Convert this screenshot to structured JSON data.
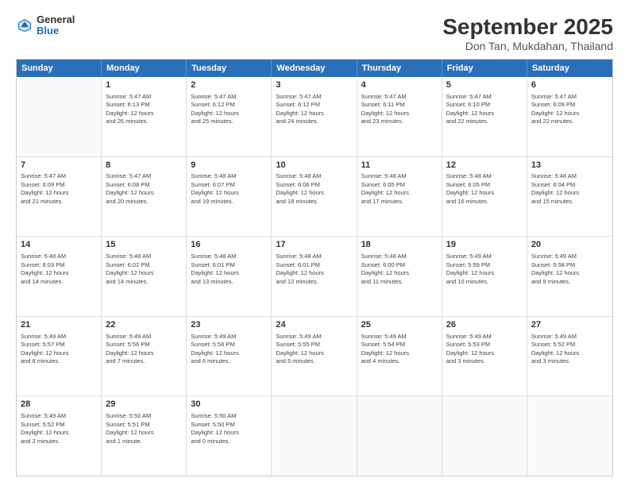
{
  "logo": {
    "general": "General",
    "blue": "Blue"
  },
  "title": "September 2025",
  "subtitle": "Don Tan, Mukdahan, Thailand",
  "headers": [
    "Sunday",
    "Monday",
    "Tuesday",
    "Wednesday",
    "Thursday",
    "Friday",
    "Saturday"
  ],
  "weeks": [
    [
      {
        "day": "",
        "text": ""
      },
      {
        "day": "1",
        "text": "Sunrise: 5:47 AM\nSunset: 6:13 PM\nDaylight: 12 hours\nand 26 minutes."
      },
      {
        "day": "2",
        "text": "Sunrise: 5:47 AM\nSunset: 6:12 PM\nDaylight: 12 hours\nand 25 minutes."
      },
      {
        "day": "3",
        "text": "Sunrise: 5:47 AM\nSunset: 6:12 PM\nDaylight: 12 hours\nand 24 minutes."
      },
      {
        "day": "4",
        "text": "Sunrise: 5:47 AM\nSunset: 6:11 PM\nDaylight: 12 hours\nand 23 minutes."
      },
      {
        "day": "5",
        "text": "Sunrise: 5:47 AM\nSunset: 6:10 PM\nDaylight: 12 hours\nand 22 minutes."
      },
      {
        "day": "6",
        "text": "Sunrise: 5:47 AM\nSunset: 6:09 PM\nDaylight: 12 hours\nand 22 minutes."
      }
    ],
    [
      {
        "day": "7",
        "text": "Sunrise: 5:47 AM\nSunset: 6:09 PM\nDaylight: 12 hours\nand 21 minutes."
      },
      {
        "day": "8",
        "text": "Sunrise: 5:47 AM\nSunset: 6:08 PM\nDaylight: 12 hours\nand 20 minutes."
      },
      {
        "day": "9",
        "text": "Sunrise: 5:48 AM\nSunset: 6:07 PM\nDaylight: 12 hours\nand 19 minutes."
      },
      {
        "day": "10",
        "text": "Sunrise: 5:48 AM\nSunset: 6:06 PM\nDaylight: 12 hours\nand 18 minutes."
      },
      {
        "day": "11",
        "text": "Sunrise: 5:48 AM\nSunset: 6:05 PM\nDaylight: 12 hours\nand 17 minutes."
      },
      {
        "day": "12",
        "text": "Sunrise: 5:48 AM\nSunset: 6:05 PM\nDaylight: 12 hours\nand 16 minutes."
      },
      {
        "day": "13",
        "text": "Sunrise: 5:48 AM\nSunset: 6:04 PM\nDaylight: 12 hours\nand 15 minutes."
      }
    ],
    [
      {
        "day": "14",
        "text": "Sunrise: 5:48 AM\nSunset: 6:03 PM\nDaylight: 12 hours\nand 14 minutes."
      },
      {
        "day": "15",
        "text": "Sunrise: 5:48 AM\nSunset: 6:02 PM\nDaylight: 12 hours\nand 14 minutes."
      },
      {
        "day": "16",
        "text": "Sunrise: 5:48 AM\nSunset: 6:01 PM\nDaylight: 12 hours\nand 13 minutes."
      },
      {
        "day": "17",
        "text": "Sunrise: 5:48 AM\nSunset: 6:01 PM\nDaylight: 12 hours\nand 12 minutes."
      },
      {
        "day": "18",
        "text": "Sunrise: 5:48 AM\nSunset: 6:00 PM\nDaylight: 12 hours\nand 11 minutes."
      },
      {
        "day": "19",
        "text": "Sunrise: 5:49 AM\nSunset: 5:59 PM\nDaylight: 12 hours\nand 10 minutes."
      },
      {
        "day": "20",
        "text": "Sunrise: 5:49 AM\nSunset: 5:58 PM\nDaylight: 12 hours\nand 9 minutes."
      }
    ],
    [
      {
        "day": "21",
        "text": "Sunrise: 5:49 AM\nSunset: 5:57 PM\nDaylight: 12 hours\nand 8 minutes."
      },
      {
        "day": "22",
        "text": "Sunrise: 5:49 AM\nSunset: 5:56 PM\nDaylight: 12 hours\nand 7 minutes."
      },
      {
        "day": "23",
        "text": "Sunrise: 5:49 AM\nSunset: 5:56 PM\nDaylight: 12 hours\nand 6 minutes."
      },
      {
        "day": "24",
        "text": "Sunrise: 5:49 AM\nSunset: 5:55 PM\nDaylight: 12 hours\nand 5 minutes."
      },
      {
        "day": "25",
        "text": "Sunrise: 5:49 AM\nSunset: 5:54 PM\nDaylight: 12 hours\nand 4 minutes."
      },
      {
        "day": "26",
        "text": "Sunrise: 5:49 AM\nSunset: 5:53 PM\nDaylight: 12 hours\nand 3 minutes."
      },
      {
        "day": "27",
        "text": "Sunrise: 5:49 AM\nSunset: 5:52 PM\nDaylight: 12 hours\nand 3 minutes."
      }
    ],
    [
      {
        "day": "28",
        "text": "Sunrise: 5:49 AM\nSunset: 5:52 PM\nDaylight: 12 hours\nand 2 minutes."
      },
      {
        "day": "29",
        "text": "Sunrise: 5:50 AM\nSunset: 5:51 PM\nDaylight: 12 hours\nand 1 minute."
      },
      {
        "day": "30",
        "text": "Sunrise: 5:50 AM\nSunset: 5:50 PM\nDaylight: 12 hours\nand 0 minutes."
      },
      {
        "day": "",
        "text": ""
      },
      {
        "day": "",
        "text": ""
      },
      {
        "day": "",
        "text": ""
      },
      {
        "day": "",
        "text": ""
      }
    ]
  ]
}
